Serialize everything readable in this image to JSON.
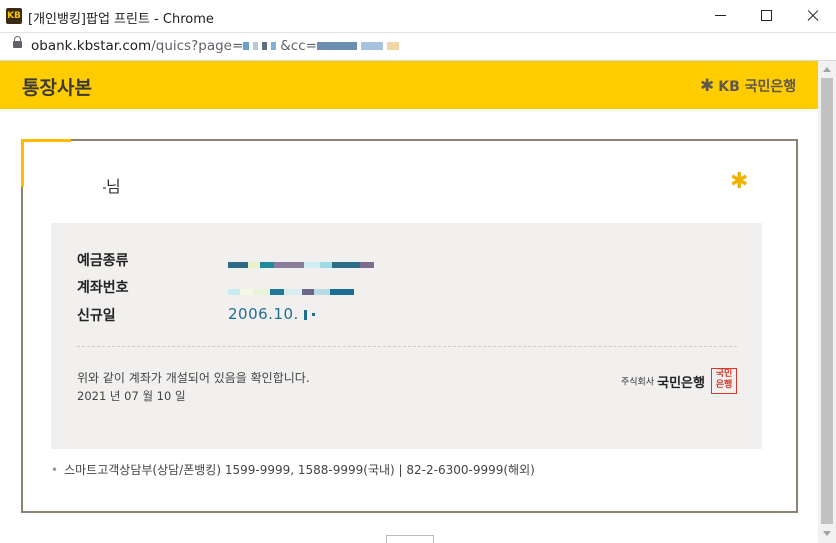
{
  "window": {
    "title": "[개인뱅킹]팝업 프린트 - Chrome",
    "app_icon_text": "KB"
  },
  "address_bar": {
    "url_host": "obank.kbstar.com",
    "url_path": "/quics?page=",
    "url_param": "&cc="
  },
  "page": {
    "title": "통장사본",
    "bank_logo_text": "KB 국민은행"
  },
  "certificate": {
    "holder_suffix": "님",
    "labels": {
      "deposit_type": "예금종류",
      "account_number": "계좌번호",
      "opened_date": "신규일"
    },
    "opened_date_value": "2006.10.",
    "confirm_text": "위와 같이 계좌가 개설되어 있음을 확인합니다.",
    "issue_date": "2021 년 07 월 10 일",
    "stamp_company": "주식회사",
    "stamp_bank": "국민은행",
    "seal_line1": "국민",
    "seal_line2": "은행"
  },
  "contact": {
    "text": "스마트고객상담부(상담/폰뱅킹) 1599-9999, 1588-9999(국내) | 82-2-6300-9999(해외)"
  },
  "colors": {
    "brand_yellow": "#ffcc00",
    "frame_border": "#8d8276",
    "date_blue": "#1e6f8f",
    "seal_red": "#d43a2a"
  }
}
